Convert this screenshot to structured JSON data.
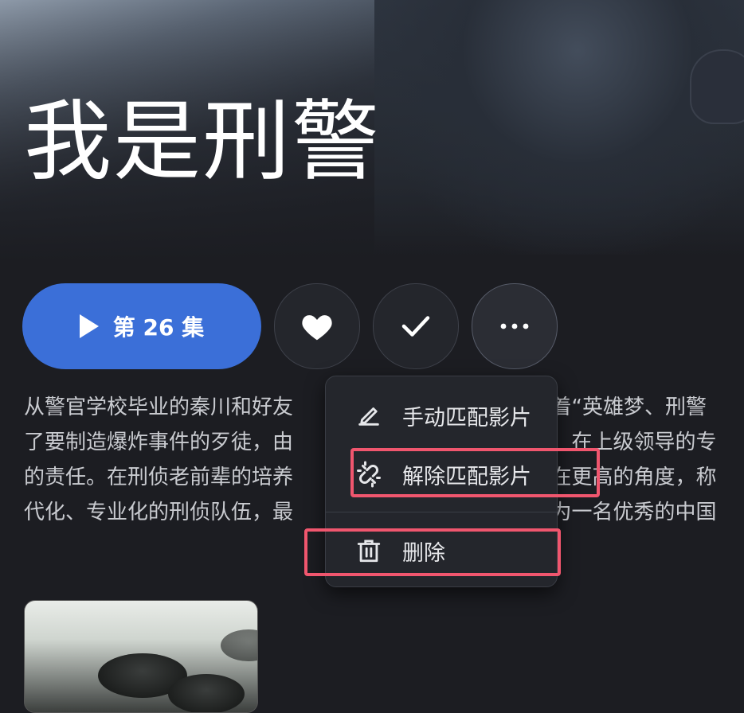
{
  "title": "我是刑警",
  "actions": {
    "play_label": "第 26 集",
    "favorite_icon": "heart-icon",
    "watched_icon": "check-icon",
    "more_icon": "more-horizontal-icon"
  },
  "description": {
    "lines": [
      "从警官学校毕业的秦川和好友                                    揣着“英雄梦、刑警",
      "了要制造爆炸事件的歹徒，由                                    现，在上级领导的专",
      "的责任。在刑侦老前辈的培养                                    站在更高的角度，称",
      "代化、专业化的刑侦队伍，最                                    成为一名优秀的中国"
    ]
  },
  "menu": {
    "items": [
      {
        "label": "手动匹配影片",
        "icon": "edit-pencil-icon"
      },
      {
        "label": "解除匹配影片",
        "icon": "unlink-icon"
      },
      {
        "label": "删除",
        "icon": "trash-icon"
      }
    ]
  },
  "colors": {
    "accent": "#3b6fd8",
    "background": "#1c1d22",
    "highlight": "#f0566e"
  }
}
